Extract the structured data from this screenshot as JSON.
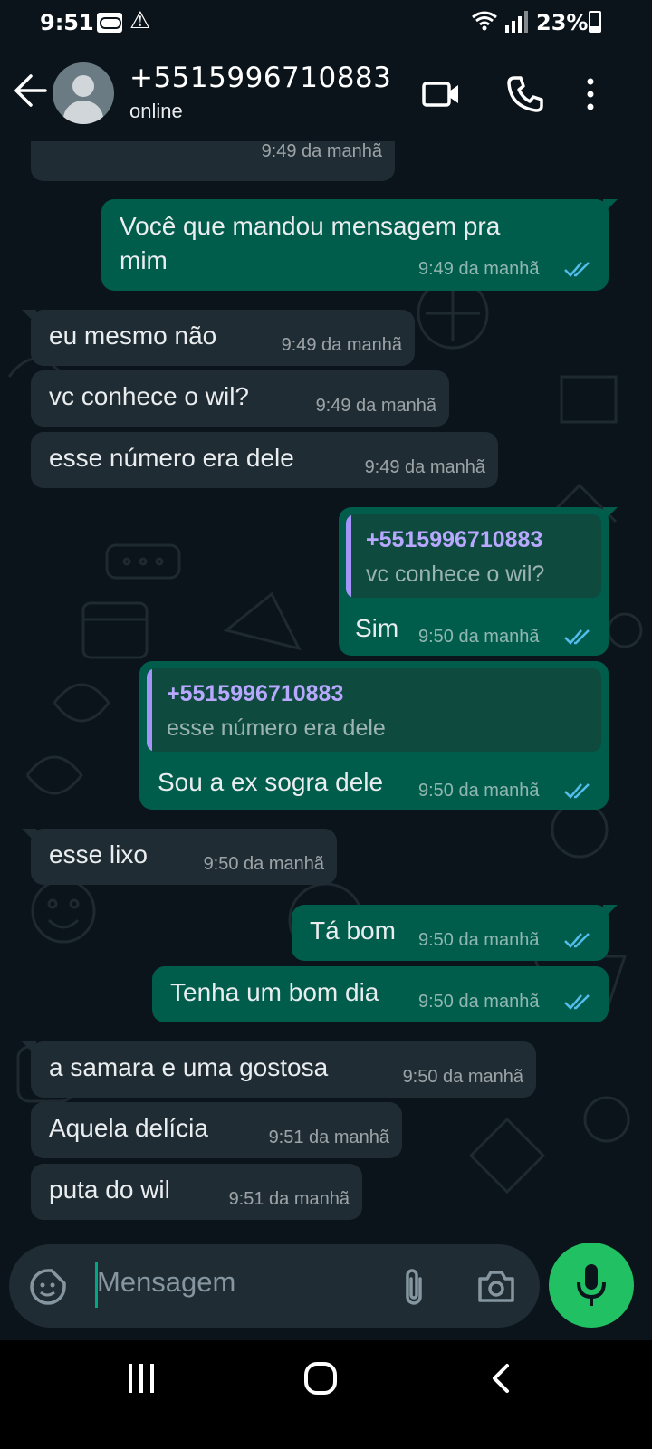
{
  "status_bar": {
    "time": "9:51",
    "battery": "23%",
    "icons": [
      "voicemail-icon",
      "warning-icon",
      "wifi-icon",
      "signal-icon",
      "battery-icon"
    ]
  },
  "header": {
    "contact": "+5515996710883",
    "status": "online",
    "icons": [
      "back-arrow-icon",
      "avatar-icon",
      "video-call-icon",
      "phone-icon",
      "more-vert-icon"
    ]
  },
  "messages": [
    {
      "dir": "in",
      "text": "",
      "time": "9:49 da manhã"
    },
    {
      "dir": "out",
      "text_line1": "Você que mandou mensagem pra",
      "text_line2": "mim",
      "time": "9:49 da manhã",
      "read": true
    },
    {
      "dir": "in",
      "text": "eu mesmo não",
      "time": "9:49 da manhã"
    },
    {
      "dir": "in",
      "text": "vc conhece o wil?",
      "time": "9:49 da manhã"
    },
    {
      "dir": "in",
      "text": "esse número era dele",
      "time": "9:49 da manhã"
    },
    {
      "dir": "out",
      "quote_author": "+5515996710883",
      "quote_text": "vc conhece o wil?",
      "text": "Sim",
      "time": "9:50 da manhã",
      "read": true
    },
    {
      "dir": "out",
      "quote_author": "+5515996710883",
      "quote_text": "esse número era dele",
      "text": "Sou a ex sogra dele",
      "time": "9:50 da manhã",
      "read": true
    },
    {
      "dir": "in",
      "text": "esse lixo",
      "time": "9:50 da manhã"
    },
    {
      "dir": "out",
      "text": "Tá bom",
      "time": "9:50 da manhã",
      "read": true
    },
    {
      "dir": "out",
      "text": "Tenha um bom dia",
      "time": "9:50 da manhã",
      "read": true
    },
    {
      "dir": "in",
      "text": "a samara e uma gostosa",
      "time": "9:50 da manhã"
    },
    {
      "dir": "in",
      "text": "Aquela delícia",
      "time": "9:51 da manhã"
    },
    {
      "dir": "in",
      "text": "puta do wil",
      "time": "9:51 da manhã"
    }
  ],
  "input": {
    "placeholder": "Mensagem",
    "icons": [
      "sticker-icon",
      "attach-icon",
      "camera-icon",
      "mic-icon"
    ]
  },
  "colors": {
    "background": "#0b141a",
    "incoming_bubble": "#202c33",
    "outgoing_bubble": "#005c4b",
    "read_ticks": "#53bdeb",
    "mic_button": "#21c063",
    "quote_author": "#b8a8ff"
  },
  "nav_bar": {
    "icons": [
      "recents-icon",
      "home-icon",
      "back-icon"
    ]
  }
}
